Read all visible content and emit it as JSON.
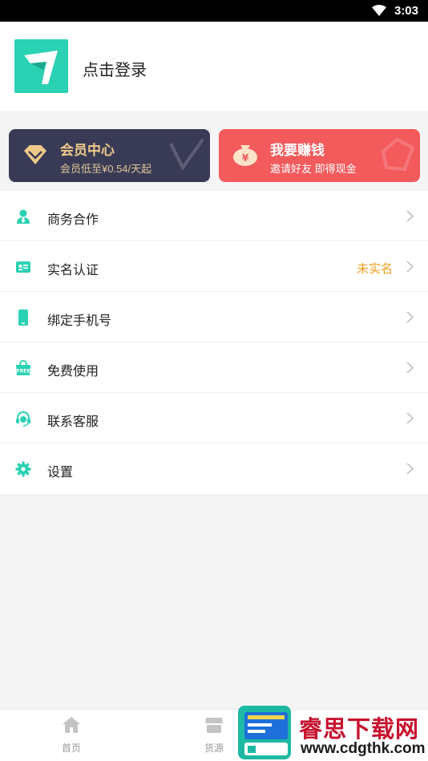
{
  "status_bar": {
    "time": "3:03"
  },
  "profile": {
    "login_label": "点击登录"
  },
  "cards": {
    "vip": {
      "title": "会员中心",
      "subtitle": "会员低至¥0.54/天起"
    },
    "earn": {
      "title": "我要赚钱",
      "subtitle": "邀请好友 即得现金"
    }
  },
  "menu": [
    {
      "label": "商务合作",
      "icon": "business-icon",
      "value": ""
    },
    {
      "label": "实名认证",
      "icon": "id-card-icon",
      "value": "未实名"
    },
    {
      "label": "绑定手机号",
      "icon": "phone-icon",
      "value": ""
    },
    {
      "label": "免费使用",
      "icon": "free-icon",
      "value": ""
    },
    {
      "label": "联系客服",
      "icon": "headset-icon",
      "value": ""
    },
    {
      "label": "设置",
      "icon": "gear-icon",
      "value": ""
    }
  ],
  "tabbar": [
    {
      "label": "首页",
      "icon": "home-icon"
    },
    {
      "label": "货源",
      "icon": "store-icon"
    }
  ],
  "watermark": {
    "title": "睿思下载网",
    "url": "www.cdgthk.com"
  },
  "colors": {
    "accent": "#2ad1b2",
    "vip_card": "#393b56",
    "earn_card": "#f25a5c",
    "status_value": "#f0a020"
  }
}
